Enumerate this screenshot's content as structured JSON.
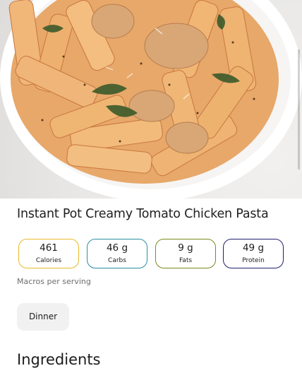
{
  "recipe": {
    "title": "Instant Pot Creamy Tomato Chicken Pasta",
    "image_alt": "Creamy tomato chicken penne pasta in a white bowl"
  },
  "macros": [
    {
      "value": "461",
      "label": "Calories",
      "color": "#e7b92c"
    },
    {
      "value": "46 g",
      "label": "Carbs",
      "color": "#2a8fa0"
    },
    {
      "value": "9 g",
      "label": "Fats",
      "color": "#7a8a1c"
    },
    {
      "value": "49 g",
      "label": "Protein",
      "color": "#1f1f6e"
    }
  ],
  "macro_note": "Macros per serving",
  "tag": {
    "label": "Dinner"
  },
  "sections": {
    "ingredients_title": "Ingredients"
  }
}
